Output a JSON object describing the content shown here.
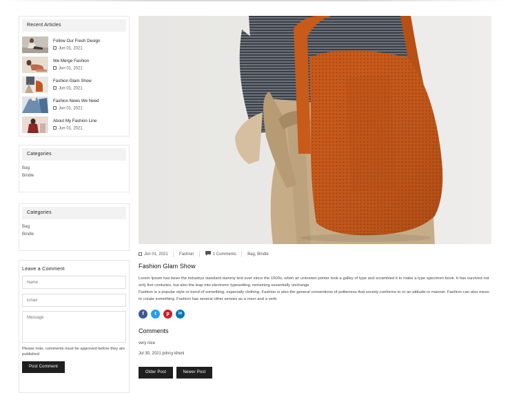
{
  "sidebar": {
    "recent": {
      "title": "Recent Articles",
      "items": [
        {
          "title": "Follow Our Fresh Design",
          "date": "Jun 01, 2021",
          "thumb": "woman-sitting-thumb"
        },
        {
          "title": "We Merge Fashion",
          "date": "Jun 01, 2021",
          "thumb": "woman-reclining-thumb"
        },
        {
          "title": "Fashion Glam Show",
          "date": "Jun 01, 2021",
          "thumb": "orange-bag-thumb"
        },
        {
          "title": "Fashion News We Need",
          "date": "Jun 01, 2021",
          "thumb": "denim-thumb"
        },
        {
          "title": "About My Fashion Line",
          "date": "Jun 01, 2021",
          "thumb": "red-top-thumb"
        }
      ]
    },
    "categories_1": {
      "title": "Categories",
      "items": [
        "Bag",
        "Bindle"
      ]
    },
    "categories_2": {
      "title": "Categories",
      "items": [
        "Bag",
        "Bindle"
      ]
    },
    "comment_form": {
      "title": "Leave a Comment",
      "name_placeholder": "Name",
      "email_placeholder": "Email",
      "message_placeholder": "Message",
      "note": "Please note, comments must be approved before they are published",
      "submit_label": "Post Comment"
    }
  },
  "post": {
    "image": "woman-with-orange-knit-bag",
    "date": "Jun 01, 2021",
    "author": "Fashion",
    "comments_count": "1 Comments",
    "tags": "Bag, Bindle",
    "title": "Fashion Glam Show",
    "body_1": "Lorem Ipsum has been the industrys standard dummy text ever since the 1500s, when an unknown printer took a galley of type and scrambled it to make a type specimen book. It has survived not only five centuries, but also the leap into electronic typesetting, remaining essentially unchange",
    "body_2": "Fashion is a popular style or trend of something, especially clothing. Fashion is also the general conventions of politeness that society conforms to or an attitude or manner. Fashion can also mean to create something. Fashion has several other senses as a noun and a verb.",
    "share": [
      {
        "network": "facebook",
        "glyph": "f",
        "color": "#3b5998"
      },
      {
        "network": "twitter",
        "glyph": "t",
        "color": "#1da1f2"
      },
      {
        "network": "pinterest",
        "glyph": "p",
        "color": "#cb2027"
      },
      {
        "network": "linkedin",
        "glyph": "in",
        "color": "#0077b5"
      }
    ]
  },
  "comments": {
    "heading": "Comments",
    "items": [
      {
        "text": "very nice",
        "meta": "Jul 30, 2021 princy kheni"
      }
    ]
  },
  "pager": {
    "older_label": "Older Post",
    "newer_label": "Newer Post"
  }
}
